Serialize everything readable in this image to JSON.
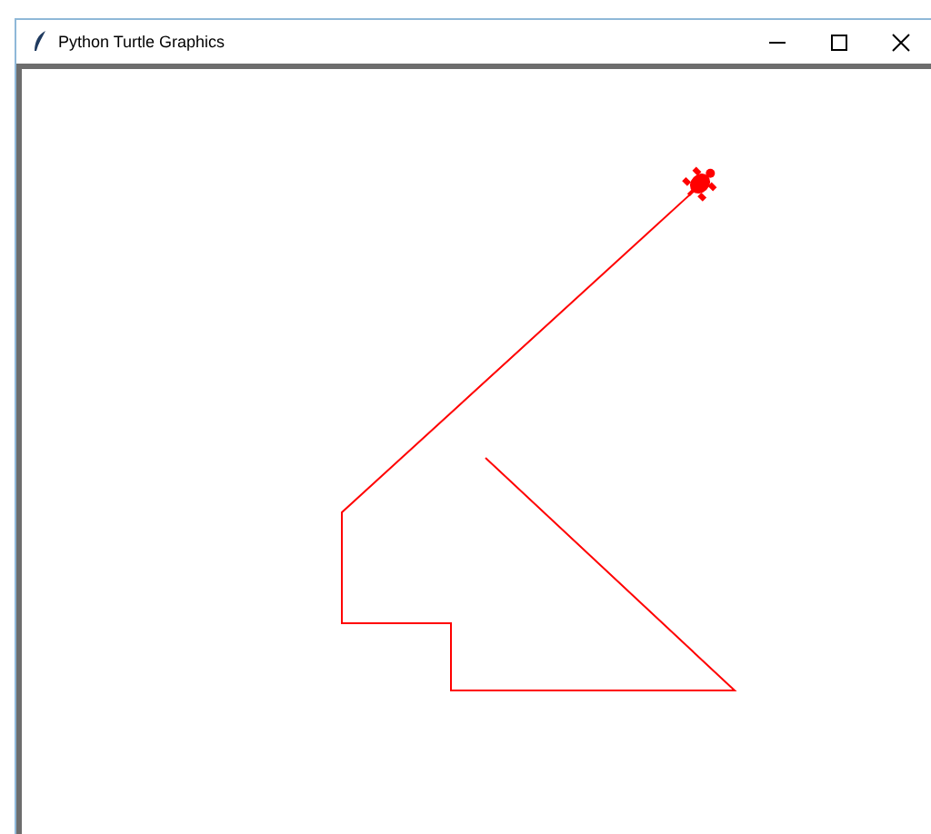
{
  "window": {
    "title": "Python Turtle Graphics"
  },
  "title_buttons": [
    {
      "kind": "minimize"
    },
    {
      "kind": "maximize"
    },
    {
      "kind": "close"
    }
  ]
}
